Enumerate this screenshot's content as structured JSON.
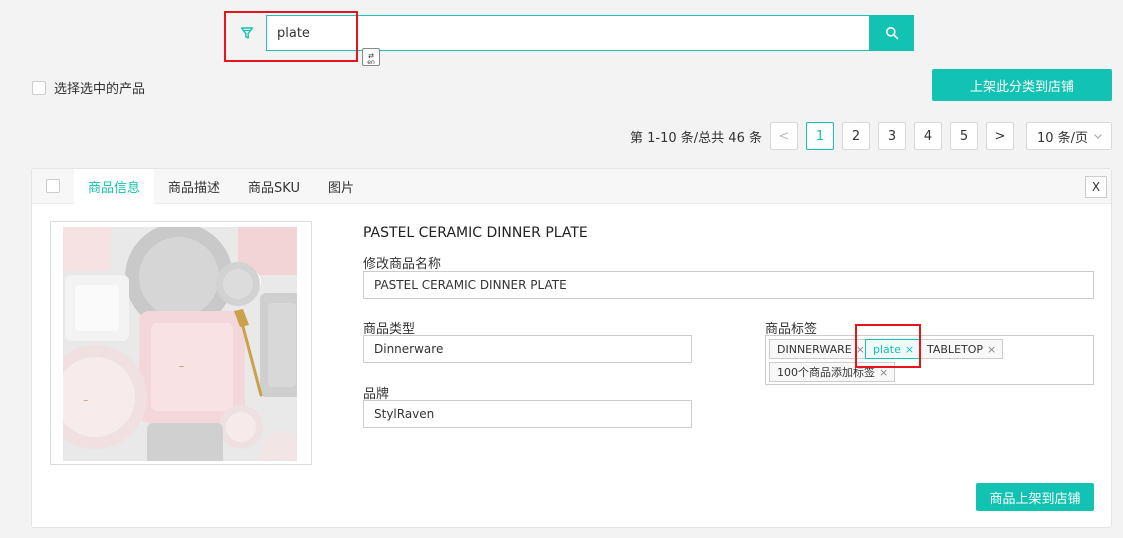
{
  "search": {
    "value": "plate",
    "ime_label": "en"
  },
  "toolbar": {
    "select_all_label": "选择选中的产品",
    "shelf_category_label": "上架此分类到店铺"
  },
  "pagination": {
    "summary": "第 1-10 条/总共 46 条",
    "prev": "<",
    "pages": [
      "1",
      "2",
      "3",
      "4",
      "5"
    ],
    "active_page": "1",
    "next": ">",
    "page_size": "10 条/页"
  },
  "product": {
    "tabs": [
      "商品信息",
      "商品描述",
      "商品SKU",
      "图片"
    ],
    "close_label": "X",
    "title": "PASTEL CERAMIC DINNER PLATE",
    "name_label": "修改商品名称",
    "name_value": "PASTEL CERAMIC DINNER PLATE",
    "type_label": "商品类型",
    "type_value": "Dinnerware",
    "brand_label": "品牌",
    "brand_value": "StylRaven",
    "tags_label": "商品标签",
    "tags": [
      "DINNERWARE",
      "plate",
      "TABLETOP",
      "100个商品添加标签"
    ],
    "tag_remove": "×",
    "shelf_label": "商品上架到店铺"
  },
  "colors": {
    "accent": "#12c2b3",
    "highlight_box": "#e8141b"
  }
}
